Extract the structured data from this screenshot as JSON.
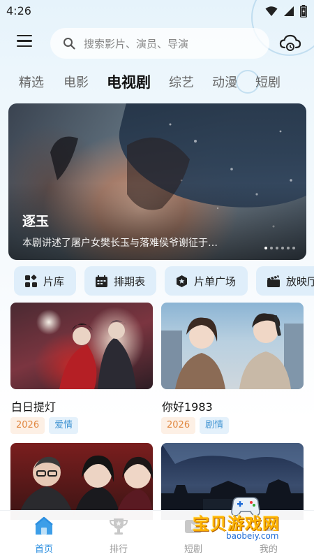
{
  "status": {
    "time": "4:26"
  },
  "header": {
    "search_placeholder": "搜索影片、演员、导演"
  },
  "tabs": [
    {
      "label": "精选",
      "active": false
    },
    {
      "label": "电影",
      "active": false
    },
    {
      "label": "电视剧",
      "active": true
    },
    {
      "label": "综艺",
      "active": false
    },
    {
      "label": "动漫",
      "active": false
    },
    {
      "label": "短剧",
      "active": false
    }
  ],
  "banner": {
    "title": "逐玉",
    "description": "本剧讲述了屠户女樊长玉与落难侯爷谢征于…",
    "page_count": 6,
    "current_page": 1
  },
  "quick_links": [
    {
      "label": "片库",
      "icon": "grid-icon"
    },
    {
      "label": "排期表",
      "icon": "calendar-icon"
    },
    {
      "label": "片单广场",
      "icon": "badge-icon"
    },
    {
      "label": "放映厅",
      "icon": "clapper-icon"
    }
  ],
  "cards": [
    {
      "title": "白日提灯",
      "year": "2026",
      "genre": "爱情"
    },
    {
      "title": "你好1983",
      "year": "2026",
      "genre": "剧情"
    }
  ],
  "nav": [
    {
      "label": "首页",
      "icon": "home-icon",
      "active": true
    },
    {
      "label": "排行",
      "icon": "trophy-icon",
      "active": false
    },
    {
      "label": "短剧",
      "icon": "video-icon",
      "active": false
    },
    {
      "label": "我的",
      "icon": "user-icon",
      "active": false
    }
  ],
  "watermark": {
    "text": "宝贝游戏网",
    "url": "baobeiy.com"
  },
  "colors": {
    "accent": "#2c8fe0",
    "tag_year": "#e08740",
    "tag_genre": "#4596d3"
  }
}
